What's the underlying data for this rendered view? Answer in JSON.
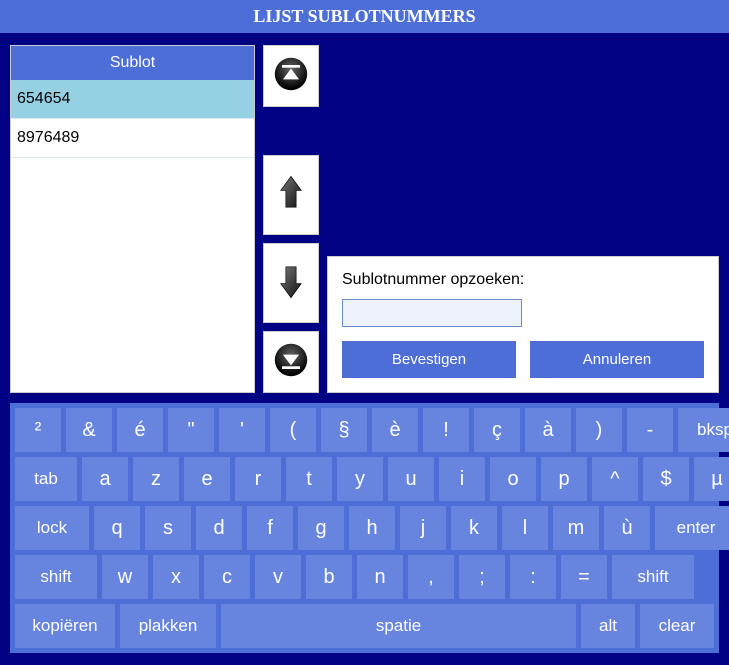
{
  "header": {
    "title": "LIJST SUBLOTNUMMERS"
  },
  "list": {
    "header": "Sublot",
    "rows": [
      "654654",
      "8976489"
    ],
    "selectedIndex": 0
  },
  "search": {
    "label": "Sublotnummer opzoeken:",
    "value": "",
    "confirm": "Bevestigen",
    "cancel": "Annuleren"
  },
  "keyboard": {
    "row1": [
      "²",
      "&",
      "é",
      "\"",
      "'",
      "(",
      "§",
      "è",
      "!",
      "ç",
      "à",
      ")",
      "-",
      "bksp"
    ],
    "row2": [
      "tab",
      "a",
      "z",
      "e",
      "r",
      "t",
      "y",
      "u",
      "i",
      "o",
      "p",
      "^",
      "$",
      "µ"
    ],
    "row3": [
      "lock",
      "q",
      "s",
      "d",
      "f",
      "g",
      "h",
      "j",
      "k",
      "l",
      "m",
      "ù",
      "enter"
    ],
    "row4": [
      "shift",
      "w",
      "x",
      "c",
      "v",
      "b",
      "n",
      ",",
      ";",
      ":",
      "=",
      "shift"
    ],
    "row5": [
      "kopiëren",
      "plakken",
      "spatie",
      "alt",
      "clear"
    ]
  }
}
